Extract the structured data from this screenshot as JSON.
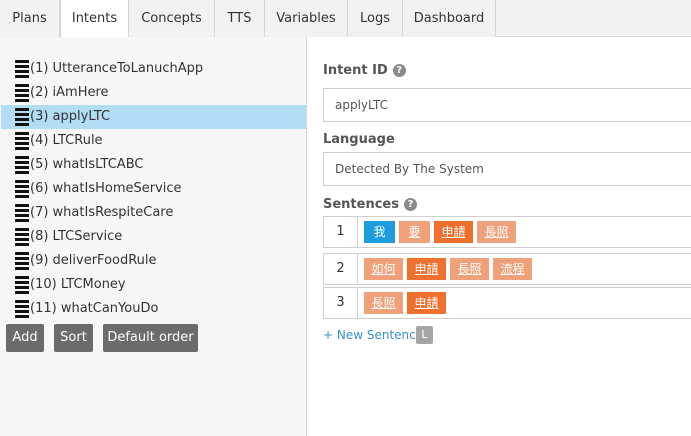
{
  "tabs": [
    "Plans",
    "Intents",
    "Concepts",
    "TTS",
    "Variables",
    "Logs",
    "Dashboard"
  ],
  "active_tab": "Intents",
  "intents": [
    "(1) UtteranceToLanuchApp",
    "(2) iAmHere",
    "(3) applyLTC",
    "(4) LTCRule",
    "(5) whatIsLTCABC",
    "(6) whatIsHomeService",
    "(7) whatIsRespiteCare",
    "(8) LTCService",
    "(9) deliverFoodRule",
    "(10) LTCMoney",
    "(11) whatCanYouDo"
  ],
  "selected_intent": "(3) applyLTC",
  "buttons": {
    "add": "Add",
    "sort": "Sort",
    "default_order": "Default order"
  },
  "detail": {
    "intent_id_label": "Intent ID",
    "intent_id_value": "applyLTC",
    "language_label": "Language",
    "language_value": "Detected By The System",
    "sentences_label": "Sentences",
    "help_glyph": "?",
    "sentences": [
      {
        "num": "1",
        "tokens": [
          {
            "text": "我",
            "style": "blue"
          },
          {
            "text": "要",
            "style": "light"
          },
          {
            "text": "申請",
            "style": "dark"
          },
          {
            "text": "長照",
            "style": "light"
          }
        ]
      },
      {
        "num": "2",
        "tokens": [
          {
            "text": "如何",
            "style": "light"
          },
          {
            "text": "申請",
            "style": "dark"
          },
          {
            "text": "長照",
            "style": "light"
          },
          {
            "text": "流程",
            "style": "light"
          }
        ]
      },
      {
        "num": "3",
        "tokens": [
          {
            "text": "長照",
            "style": "light"
          },
          {
            "text": "申請",
            "style": "dark"
          }
        ]
      }
    ],
    "new_sentence_label": "+ New Sentence",
    "new_sentence_badge": "L"
  },
  "colors": {
    "selected_row": "#b3dcf5",
    "token_blue": "#1e9ce0",
    "token_light": "#f0a07a",
    "token_dark": "#ef6f2e",
    "button": "#6b6b6b"
  }
}
